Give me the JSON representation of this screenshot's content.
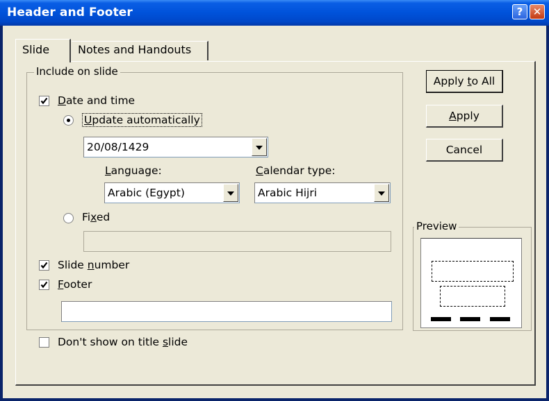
{
  "window": {
    "title": "Header and Footer",
    "help_glyph": "?",
    "close_glyph": "✕"
  },
  "tabs": [
    {
      "label": "Slide",
      "active": true
    },
    {
      "label": "Notes and Handouts",
      "active": false
    }
  ],
  "include_group": {
    "legend": "Include on slide"
  },
  "date_time": {
    "pre": "",
    "accel": "D",
    "post": "ate and time",
    "checked": true
  },
  "update_auto": {
    "pre": "",
    "accel": "U",
    "post": "pdate automatically",
    "selected": true
  },
  "date_combo": {
    "value": "20/08/1429"
  },
  "language": {
    "pre": "",
    "accel": "L",
    "post": "anguage:",
    "value": "Arabic (Egypt)"
  },
  "calendar": {
    "pre": "",
    "accel": "C",
    "post": "alendar type:",
    "value": "Arabic Hijri"
  },
  "fixed": {
    "pre": "Fi",
    "accel": "x",
    "post": "ed",
    "selected": false,
    "value": ""
  },
  "slide_number": {
    "pre": "Slide ",
    "accel": "n",
    "post": "umber",
    "checked": true
  },
  "footer": {
    "pre": "",
    "accel": "F",
    "post": "ooter",
    "checked": true,
    "value": ""
  },
  "dont_show": {
    "pre": "Don't show on title ",
    "accel": "s",
    "post": "lide",
    "checked": false
  },
  "buttons": {
    "apply_all": {
      "pre": "Apply ",
      "accel": "t",
      "post": "o All"
    },
    "apply": {
      "pre": "",
      "accel": "A",
      "post": "pply"
    },
    "cancel": {
      "label": "Cancel"
    }
  },
  "preview": {
    "legend": "Preview"
  }
}
